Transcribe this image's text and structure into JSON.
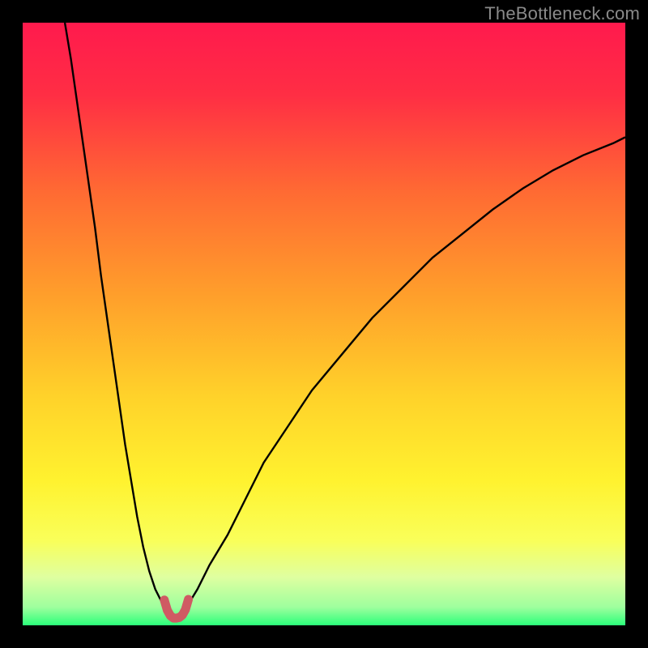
{
  "watermark": "TheBottleneck.com",
  "chart_data": {
    "type": "line",
    "title": "",
    "xlabel": "",
    "ylabel": "",
    "xlim": [
      0,
      100
    ],
    "ylim": [
      0,
      100
    ],
    "grid": false,
    "background_gradient_stops": [
      {
        "offset": 0.0,
        "color": "#ff1a4d"
      },
      {
        "offset": 0.12,
        "color": "#ff2e44"
      },
      {
        "offset": 0.28,
        "color": "#ff6a33"
      },
      {
        "offset": 0.45,
        "color": "#ff9e2b"
      },
      {
        "offset": 0.62,
        "color": "#ffd22a"
      },
      {
        "offset": 0.76,
        "color": "#fff22f"
      },
      {
        "offset": 0.86,
        "color": "#f9ff5a"
      },
      {
        "offset": 0.92,
        "color": "#dfffa0"
      },
      {
        "offset": 0.97,
        "color": "#9eff9e"
      },
      {
        "offset": 1.0,
        "color": "#2bff7a"
      }
    ],
    "series": [
      {
        "name": "left-branch",
        "stroke": "#000000",
        "stroke_width": 2.4,
        "x": [
          7,
          8,
          9,
          10,
          11,
          12,
          13,
          14,
          15,
          16,
          17,
          18,
          19,
          20,
          21,
          22,
          23,
          24
        ],
        "y": [
          100,
          94,
          87,
          80,
          73,
          66,
          58,
          51,
          44,
          37,
          30,
          24,
          18,
          13,
          9,
          6,
          4,
          2.7
        ]
      },
      {
        "name": "right-branch",
        "stroke": "#000000",
        "stroke_width": 2.4,
        "x": [
          27,
          29,
          31,
          34,
          37,
          40,
          44,
          48,
          53,
          58,
          63,
          68,
          73,
          78,
          83,
          88,
          93,
          98,
          100
        ],
        "y": [
          2.7,
          6,
          10,
          15,
          21,
          27,
          33,
          39,
          45,
          51,
          56,
          61,
          65,
          69,
          72.5,
          75.5,
          78,
          80,
          81
        ]
      },
      {
        "name": "trough-marker",
        "stroke": "#cf5a63",
        "stroke_width": 11,
        "linecap": "round",
        "x": [
          23.5,
          24,
          24.5,
          25,
          25.5,
          26,
          26.5,
          27,
          27.5
        ],
        "y": [
          4.2,
          2.5,
          1.6,
          1.2,
          1.2,
          1.3,
          1.7,
          2.6,
          4.3
        ]
      }
    ]
  }
}
